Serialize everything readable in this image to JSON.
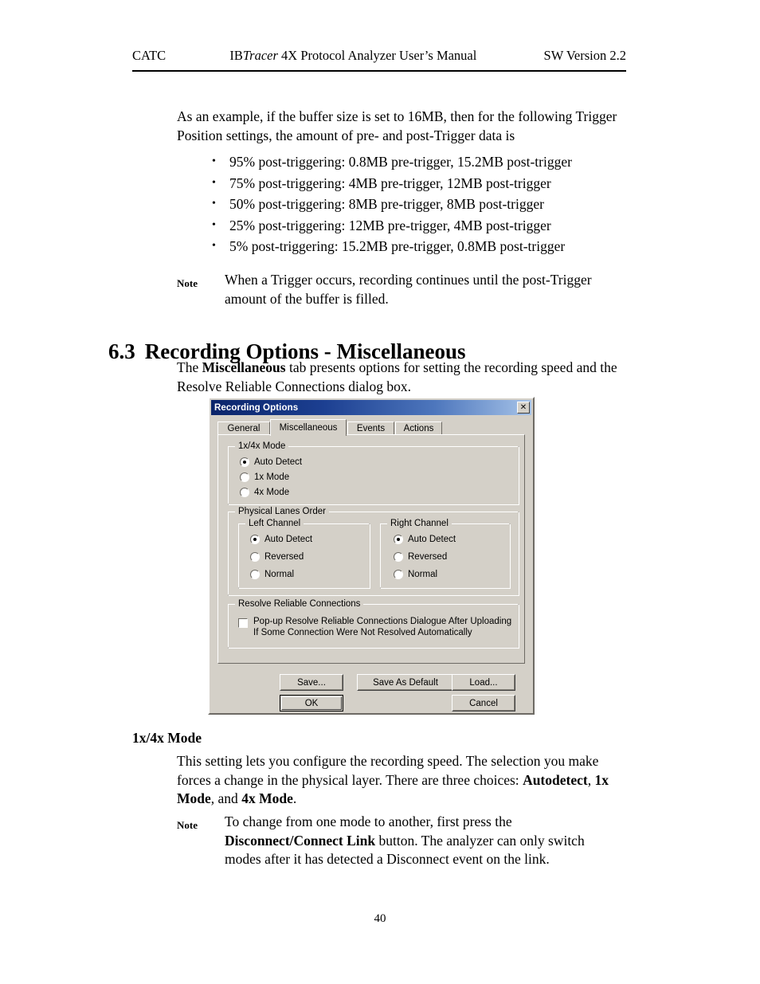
{
  "header": {
    "left": "CATC",
    "center_prefix": "IB",
    "center_italic": "Tracer",
    "center_suffix": " 4X Protocol Analyzer User’s Manual",
    "right": "SW Version 2.2"
  },
  "intro": {
    "line1": "As an example, if the buffer size is set to 16MB, then for the following",
    "line2": "Trigger Position settings, the amount of pre- and post-Trigger data is"
  },
  "bullets": [
    "95% post-triggering: 0.8MB pre-trigger, 15.2MB post-trigger",
    "75% post-triggering: 4MB pre-trigger, 12MB post-trigger",
    "50% post-triggering: 8MB pre-trigger, 8MB post-trigger",
    "25% post-triggering: 12MB pre-trigger, 4MB post-trigger",
    "5% post-triggering: 15.2MB pre-trigger, 0.8MB post-trigger"
  ],
  "note1": {
    "label": "Note",
    "text": "When a Trigger occurs, recording continues until the post-Trigger amount of the buffer is filled."
  },
  "section": {
    "number": "6.3",
    "title": "Recording Options - Miscellaneous"
  },
  "misc_para": {
    "part1": "The ",
    "bold1": "Miscellaneous",
    "part2": " tab presents options for setting the recording speed and the Resolve Reliable Connections dialog box."
  },
  "dialog": {
    "title": "Recording Options",
    "close_label": "✕",
    "tabs": [
      {
        "label": "General",
        "active": false
      },
      {
        "label": "Miscellaneous",
        "active": true
      },
      {
        "label": "Events",
        "active": false
      },
      {
        "label": "Actions",
        "active": false
      }
    ],
    "group_mode": {
      "title": "1x/4x Mode",
      "options": [
        {
          "label": "Auto Detect",
          "selected": true
        },
        {
          "label": "1x Mode",
          "selected": false
        },
        {
          "label": "4x Mode",
          "selected": false
        }
      ]
    },
    "group_lanes": {
      "title": "Physical Lanes Order",
      "left_channel": {
        "title": "Left Channel",
        "options": [
          {
            "label": "Auto Detect",
            "selected": true
          },
          {
            "label": "Reversed",
            "selected": false
          },
          {
            "label": "Normal",
            "selected": false
          }
        ]
      },
      "right_channel": {
        "title": "Right Channel",
        "options": [
          {
            "label": "Auto Detect",
            "selected": true
          },
          {
            "label": "Reversed",
            "selected": false
          },
          {
            "label": "Normal",
            "selected": false
          }
        ]
      }
    },
    "group_resolve": {
      "title": "Resolve Reliable Connections",
      "checkbox_checked": false,
      "checkbox_line1": "Pop-up Resolve Reliable Connections Dialogue After Uploading",
      "checkbox_line2": "If Some Connection Were Not Resolved Automatically"
    },
    "buttons": {
      "save": "Save...",
      "save_as_default": "Save As Default",
      "load": "Load...",
      "ok": "OK",
      "cancel": "Cancel"
    },
    "colors": {
      "face": "#d4d0c8",
      "title_start": "#0a246a",
      "title_end": "#a6c3e8"
    }
  },
  "sub_heading": "1x/4x Mode",
  "mode_para": {
    "part1": "This setting lets you configure the recording speed.  The selection you make forces a change in the physical layer.  There are three choices: ",
    "bold1": "Autodetect",
    "part2": ", ",
    "bold2": "1x Mode",
    "part3": ", and ",
    "bold3": "4x Mode",
    "part4": "."
  },
  "note2": {
    "label": "Note",
    "part1": "To change from one mode to another, first press the ",
    "bold1": "Disconnect/Connect Link",
    "part2": " button. The analyzer can only switch modes after it has detected a Disconnect event on the link."
  },
  "page_number": "40"
}
